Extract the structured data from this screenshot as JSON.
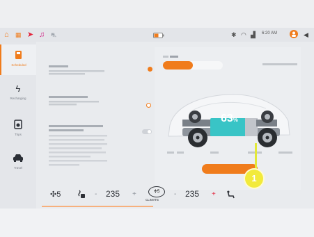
{
  "status_bar": {
    "time": "6:20 AM",
    "icons": [
      "home-icon",
      "grid-icon",
      "navigation-icon",
      "music-icon",
      "car-icon",
      "battery-icon",
      "bluetooth-icon",
      "wifi-icon",
      "signal-icon",
      "profile-icon",
      "volume-icon"
    ]
  },
  "sidebar": {
    "items": [
      {
        "label": "Scheduled",
        "icon": "fuel-icon",
        "active": true
      },
      {
        "label": "Recharging",
        "icon": "lightning-icon",
        "active": false
      },
      {
        "label": "Trips",
        "icon": "clock-icon",
        "active": false
      },
      {
        "label": "Travel",
        "icon": "car-front-icon",
        "active": false
      }
    ]
  },
  "settings": {
    "section_header": "",
    "items": [
      {
        "title": "",
        "description": "",
        "control": "radio-filled"
      },
      {
        "title": "",
        "description": "",
        "control": "radio-ring"
      },
      {
        "title": "",
        "description": "",
        "control": "toggle-off"
      }
    ]
  },
  "charge_panel": {
    "tabs": [
      "",
      ""
    ],
    "active_tab": 0,
    "battery_percent": "63",
    "percent_unit": "%",
    "button_label": ""
  },
  "climate": {
    "fan_speed": "5",
    "left_temp": "235",
    "right_temp": "235",
    "minus": "-",
    "plus": "+",
    "climate_label": "CLIMATE"
  },
  "annotation": {
    "number": "1"
  },
  "colors": {
    "accent": "#f07c1c",
    "marker": "#f2ea3b",
    "cell": "#39c4c6"
  }
}
